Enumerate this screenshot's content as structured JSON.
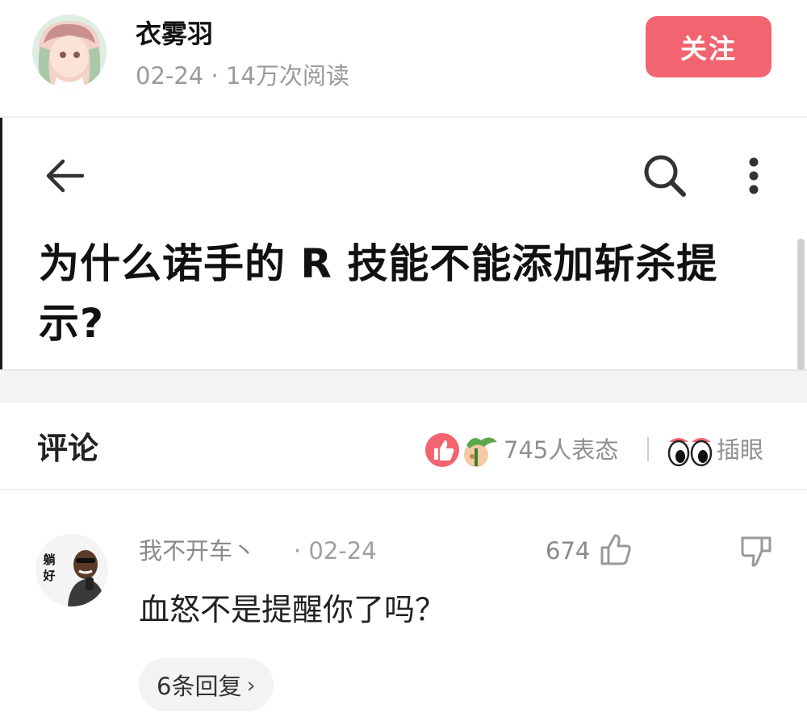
{
  "header": {
    "author_name": "衣雾羽",
    "date": "02-24",
    "reads": "14万次阅读",
    "follow_label": "关注"
  },
  "post": {
    "title": "为什么诺手的 R 技能不能添加斩杀提示?"
  },
  "comments_header": {
    "title": "评论",
    "reactions_text": "745人表态",
    "eyes_label": "插眼"
  },
  "comment": {
    "author": "我不开车丶",
    "date": "· 02-24",
    "likes": "674",
    "text": "血怒不是提醒你了吗？",
    "replies_label": "6条回复",
    "avatar_text": "躺好"
  },
  "colors": {
    "follow": "#f2646f",
    "muted": "#8f8f8f",
    "text": "#222222"
  },
  "icons": {
    "back": "arrow-left-icon",
    "search": "search-icon",
    "more": "more-vertical-icon",
    "like": "thumbs-up-icon",
    "dislike": "thumbs-down-icon",
    "reaction": "like-reaction-icon",
    "eyes": "eyes-icon"
  }
}
